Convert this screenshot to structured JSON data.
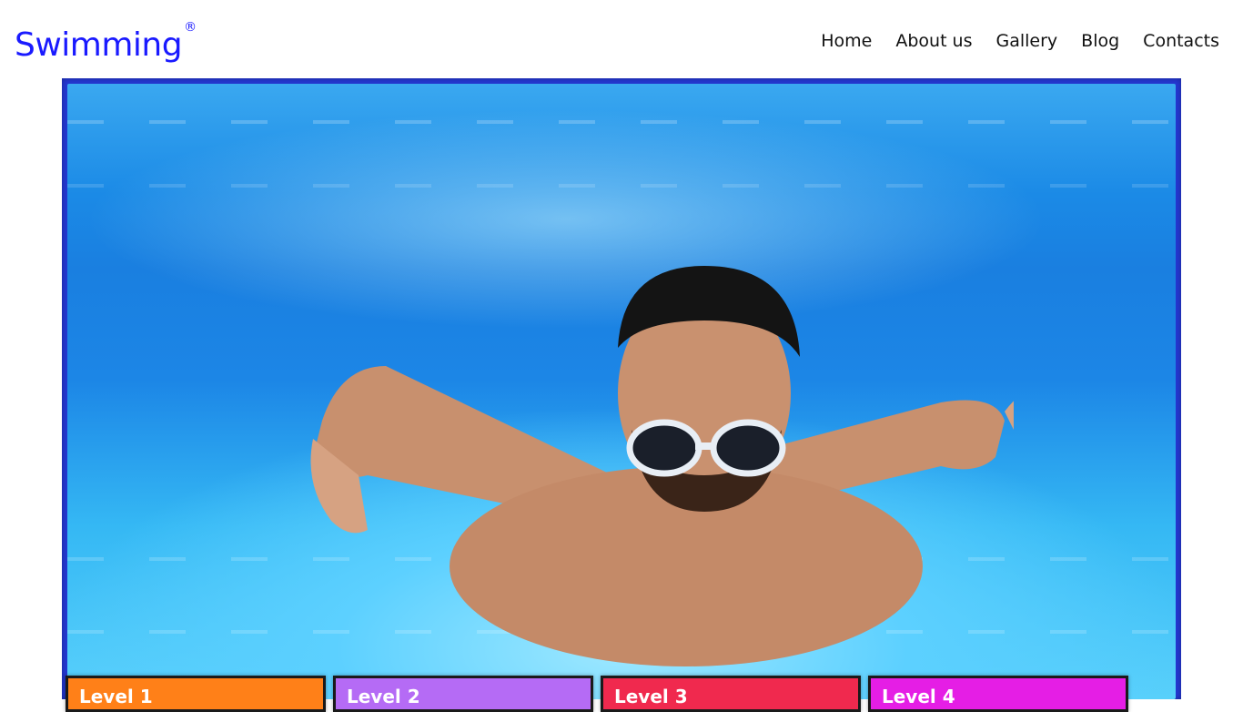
{
  "header": {
    "logo": {
      "text": "Swimming",
      "mark": "®"
    },
    "nav": [
      "Home",
      "About us",
      "Gallery",
      "Blog",
      "Contacts"
    ]
  },
  "hero": {
    "image": "underwater-swimmer-photo"
  },
  "levels": [
    {
      "label": "Level 1",
      "color": "#ff8018"
    },
    {
      "label": "Level 2",
      "color": "#b56bf5"
    },
    {
      "label": "Level 3",
      "color": "#f0294e"
    },
    {
      "label": "Level 4",
      "color": "#e51ee5"
    }
  ],
  "colors": {
    "accent": "#1a1aff",
    "frame": "#2437d0"
  }
}
